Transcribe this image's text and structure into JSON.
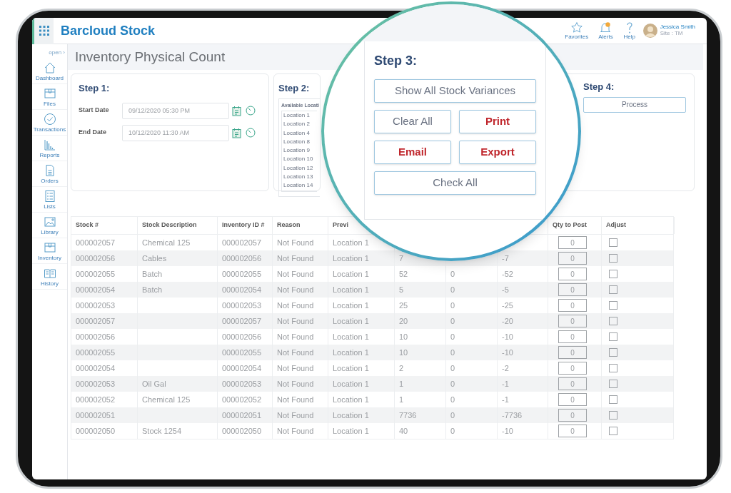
{
  "app": {
    "title": "Barcloud Stock"
  },
  "header_actions": [
    {
      "label": "Favorites",
      "kind": "favorites"
    },
    {
      "label": "Alerts",
      "kind": "alerts"
    },
    {
      "label": "Help",
      "kind": "help"
    }
  ],
  "user": {
    "name": "Jessica Smith",
    "subtitle": "Site : TM"
  },
  "sidebar": {
    "toggle": "open ›",
    "items": [
      {
        "label": "Dashboard",
        "kind": "home"
      },
      {
        "label": "Files",
        "kind": "box"
      },
      {
        "label": "Transactions",
        "kind": "check"
      },
      {
        "label": "Reports",
        "kind": "chart"
      },
      {
        "label": "Orders",
        "kind": "doc"
      },
      {
        "label": "Lists",
        "kind": "list"
      },
      {
        "label": "Library",
        "kind": "image"
      },
      {
        "label": "Inventory",
        "kind": "box"
      },
      {
        "label": "History",
        "kind": "book"
      }
    ]
  },
  "page_title": "Inventory Physical Count",
  "step1": {
    "title": "Step 1:",
    "fields": [
      {
        "label": "Start Date",
        "value": "09/12/2020 05:30 PM"
      },
      {
        "label": "End Date",
        "value": "10/12/2020 11:30 AM"
      }
    ]
  },
  "step2": {
    "title": "Step 2:",
    "list_heading": "Available Locati",
    "locations": [
      "Location 1",
      "Location 2",
      "Location 4",
      "Location 8",
      "Location 9",
      "Location 10",
      "Location 12",
      "Location 13",
      "Location 14"
    ]
  },
  "step3": {
    "title": "Step 3:",
    "button_rows": [
      [
        {
          "label": "Show All Stock Variances",
          "accent": false
        }
      ],
      [
        {
          "label": "Clear All",
          "accent": false
        },
        {
          "label": "Print",
          "accent": true
        }
      ],
      [
        {
          "label": "Email",
          "accent": true
        },
        {
          "label": "Export",
          "accent": true
        }
      ],
      [
        {
          "label": "Check All",
          "accent": false
        }
      ]
    ]
  },
  "step4": {
    "title": "Step 4:",
    "button": "Process"
  },
  "table": {
    "columns": [
      "Stock #",
      "Stock Description",
      "Inventory ID #",
      "Reason",
      "Previ",
      "Qty to Post",
      "Adjust"
    ],
    "rows": [
      {
        "stock": "000002057",
        "description": "Chemical 125",
        "inventory_id": "000002057",
        "reason": "Not Found",
        "previous_location": "Location 1",
        "qty_to_post": "0",
        "adjust_checked": false
      },
      {
        "stock": "000002056",
        "description": "Cables",
        "inventory_id": "000002056",
        "reason": "Not Found",
        "previous_location": "Location 1",
        "column_6": "7",
        "column_8": "-7",
        "qty_to_post": "0",
        "adjust_checked": false
      },
      {
        "stock": "000002055",
        "description": "Batch",
        "inventory_id": "000002055",
        "reason": "Not Found",
        "previous_location": "Location 1",
        "column_6": "52",
        "column_7": "0",
        "column_8": "-52",
        "qty_to_post": "0",
        "adjust_checked": false
      },
      {
        "stock": "000002054",
        "description": "Batch",
        "inventory_id": "000002054",
        "reason": "Not Found",
        "previous_location": "Location 1",
        "column_6": "5",
        "column_7": "0",
        "column_8": "-5",
        "qty_to_post": "0",
        "adjust_checked": false
      },
      {
        "stock": "000002053",
        "inventory_id": "000002053",
        "reason": "Not Found",
        "previous_location": "Location 1",
        "column_6": "25",
        "column_7": "0",
        "column_8": "-25",
        "qty_to_post": "0",
        "adjust_checked": false
      },
      {
        "stock": "000002057",
        "inventory_id": "000002057",
        "reason": "Not Found",
        "previous_location": "Location 1",
        "column_6": "20",
        "column_7": "0",
        "column_8": "-20",
        "qty_to_post": "0",
        "adjust_checked": false
      },
      {
        "stock": "000002056",
        "inventory_id": "000002056",
        "reason": "Not Found",
        "previous_location": "Location 1",
        "column_6": "10",
        "column_7": "0",
        "column_8": "-10",
        "qty_to_post": "0",
        "adjust_checked": false
      },
      {
        "stock": "000002055",
        "inventory_id": "000002055",
        "reason": "Not Found",
        "previous_location": "Location 1",
        "column_6": "10",
        "column_7": "0",
        "column_8": "-10",
        "qty_to_post": "0",
        "adjust_checked": false
      },
      {
        "stock": "000002054",
        "inventory_id": "000002054",
        "reason": "Not Found",
        "previous_location": "Location 1",
        "column_6": "2",
        "column_7": "0",
        "column_8": "-2",
        "qty_to_post": "0",
        "adjust_checked": false
      },
      {
        "stock": "000002053",
        "description": "Oil Gal",
        "inventory_id": "000002053",
        "reason": "Not Found",
        "previous_location": "Location 1",
        "column_6": "1",
        "column_7": "0",
        "column_8": "-1",
        "qty_to_post": "0",
        "adjust_checked": false
      },
      {
        "stock": "000002052",
        "description": "Chemical 125",
        "inventory_id": "000002052",
        "reason": "Not Found",
        "previous_location": "Location 1",
        "column_6": "1",
        "column_7": "0",
        "column_8": "-1",
        "qty_to_post": "0",
        "adjust_checked": false
      },
      {
        "stock": "000002051",
        "inventory_id": "000002051",
        "reason": "Not Found",
        "previous_location": "Location 1",
        "column_6": "7736",
        "column_7": "0",
        "column_8": "-7736",
        "qty_to_post": "0",
        "adjust_checked": false
      },
      {
        "stock": "000002050",
        "description": "Stock 1254",
        "inventory_id": "000002050",
        "reason": "Not Found",
        "previous_location": "Location 1",
        "column_6": "40",
        "column_7": "0",
        "column_8": "-10",
        "qty_to_post": "0",
        "adjust_checked": false
      }
    ]
  }
}
